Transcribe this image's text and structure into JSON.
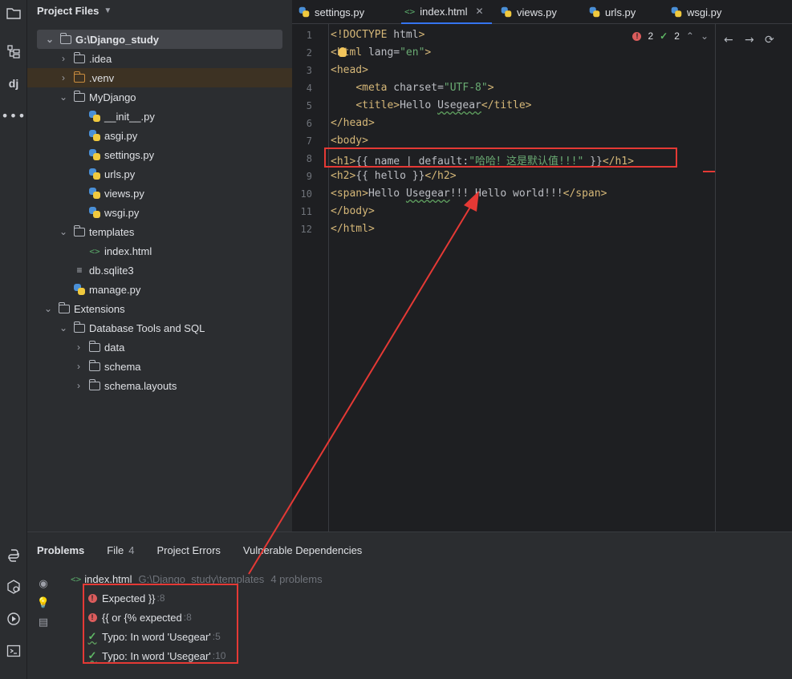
{
  "sidebar": {
    "icons": [
      "folder-icon",
      "structure-icon",
      "django-icon",
      "more-icon"
    ],
    "bottom_icons": [
      "python-console-icon",
      "python-packages-icon",
      "services-icon",
      "terminal-icon"
    ]
  },
  "project": {
    "title": "Project Files",
    "tree": [
      {
        "label": "G:\\Django_study",
        "kind": "folder",
        "expanded": true
      },
      {
        "label": ".idea",
        "kind": "folder",
        "expanded": false
      },
      {
        "label": ".venv",
        "kind": "folder-excluded",
        "expanded": false
      },
      {
        "label": "MyDjango",
        "kind": "package",
        "expanded": true
      },
      {
        "label": "__init__.py",
        "kind": "python"
      },
      {
        "label": "asgi.py",
        "kind": "python"
      },
      {
        "label": "settings.py",
        "kind": "python"
      },
      {
        "label": "urls.py",
        "kind": "python"
      },
      {
        "label": "views.py",
        "kind": "python"
      },
      {
        "label": "wsgi.py",
        "kind": "python"
      },
      {
        "label": "templates",
        "kind": "folder",
        "expanded": true
      },
      {
        "label": "index.html",
        "kind": "html"
      },
      {
        "label": "db.sqlite3",
        "kind": "database"
      },
      {
        "label": "manage.py",
        "kind": "python"
      },
      {
        "label": "Extensions",
        "kind": "folder",
        "expanded": true
      },
      {
        "label": "Database Tools and SQL",
        "kind": "folder",
        "expanded": true
      },
      {
        "label": "data",
        "kind": "folder",
        "expanded": false
      },
      {
        "label": "schema",
        "kind": "folder",
        "expanded": false
      },
      {
        "label": "schema.layouts",
        "kind": "folder",
        "expanded": false
      }
    ]
  },
  "tabs": [
    {
      "label": "settings.py",
      "kind": "python",
      "active": false
    },
    {
      "label": "index.html",
      "kind": "html",
      "active": true
    },
    {
      "label": "views.py",
      "kind": "python",
      "active": false
    },
    {
      "label": "urls.py",
      "kind": "python",
      "active": false
    },
    {
      "label": "wsgi.py",
      "kind": "python",
      "active": false
    }
  ],
  "editor": {
    "inspections": {
      "errors": "2",
      "typos": "2"
    },
    "line_numbers": [
      "1",
      "2",
      "3",
      "4",
      "5",
      "6",
      "7",
      "8",
      "9",
      "10",
      "11",
      "12"
    ],
    "lines": [
      "<!DOCTYPE html>",
      "<html lang=\"en\">",
      "<head>",
      "    <meta charset=\"UTF-8\">",
      "    <title>Hello Usegear</title>",
      "</head>",
      "<body>",
      "<h1>{{ name | default:\"哈哈！这是默认值!!!\" }}</h1>",
      "<h2>{{ hello }}</h2>",
      "<span>Hello Usegear!!! Hello world!!!</span>",
      "</body>",
      "</html>"
    ]
  },
  "problems": {
    "tabs": [
      {
        "label": "Problems"
      },
      {
        "label": "File",
        "count": "4"
      },
      {
        "label": "Project Errors"
      },
      {
        "label": "Vulnerable Dependencies"
      }
    ],
    "file": {
      "name": "index.html",
      "path": "G:\\Django_study\\templates",
      "summary": "4 problems"
    },
    "items": [
      {
        "text": "Expected }}",
        "line": ":8",
        "severity": "error"
      },
      {
        "text": "{{ or {% expected",
        "line": ":8",
        "severity": "error"
      },
      {
        "text": "Typo: In word 'Usegear'",
        "line": ":5",
        "severity": "typo"
      },
      {
        "text": "Typo: In word 'Usegear'",
        "line": ":10",
        "severity": "typo"
      }
    ]
  },
  "colors": {
    "annotation_red": "#e53935",
    "accent": "#3574f0",
    "error": "#db5c5c",
    "typo": "#5fb865"
  }
}
